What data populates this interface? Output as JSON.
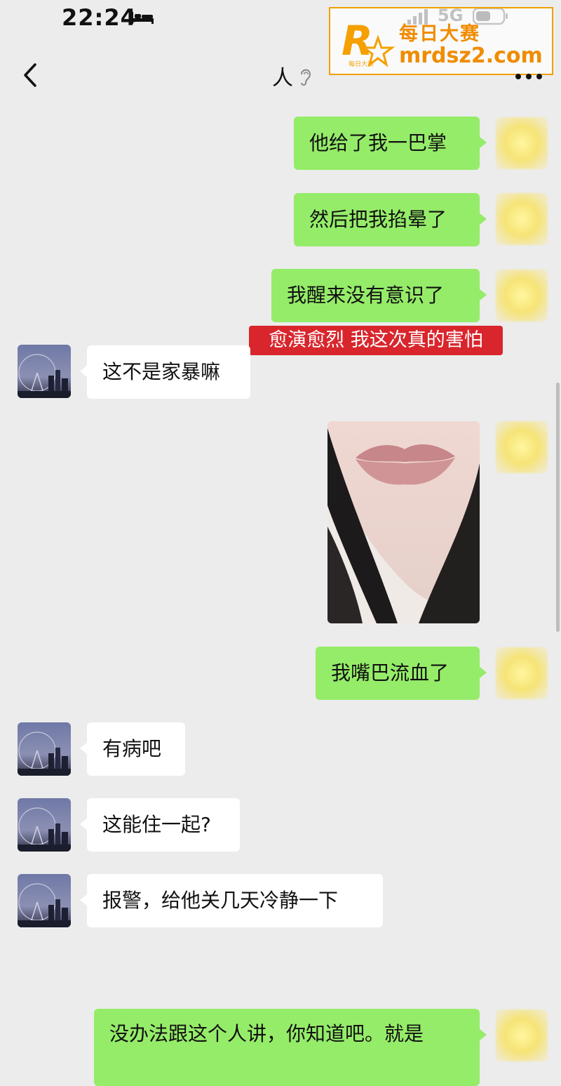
{
  "status_bar": {
    "time": "22:24",
    "network": "5G",
    "icons": [
      "bed-icon",
      "signal-icon",
      "battery-icon"
    ]
  },
  "header": {
    "title": "人",
    "icons": [
      "back-arrow-icon",
      "ear-icon",
      "more-icon"
    ]
  },
  "watermark": {
    "logo_letter": "R",
    "logo_small": "每日大赛",
    "name": "每日大赛",
    "url": "mrdsz2.com"
  },
  "messages": [
    {
      "sender": "me",
      "type": "text",
      "lines": [
        "他给了我一巴掌"
      ]
    },
    {
      "sender": "me",
      "type": "text",
      "lines": [
        "然后把我掐晕了"
      ]
    },
    {
      "sender": "me",
      "type": "text",
      "lines": [
        "我醒来没有意识了"
      ]
    },
    {
      "sender": "them",
      "type": "text",
      "lines": [
        "这不是家暴嘛"
      ]
    },
    {
      "sender": "me",
      "type": "image",
      "description": "photo-lips"
    },
    {
      "sender": "me",
      "type": "text",
      "lines": [
        "我嘴巴流血了"
      ]
    },
    {
      "sender": "them",
      "type": "text",
      "lines": [
        "有病吧"
      ]
    },
    {
      "sender": "them",
      "type": "text",
      "lines": [
        "这能住一起?"
      ]
    },
    {
      "sender": "them",
      "type": "text",
      "lines": [
        "报警，给他关几天冷静一下"
      ]
    },
    {
      "sender": "me",
      "type": "text",
      "lines": [
        "没办法跟这个人讲，你知道吧。就是"
      ]
    }
  ],
  "caption": "愈演愈烈 我这次真的害怕",
  "colors": {
    "my_bubble": "#95ec69",
    "their_bubble": "#ffffff",
    "background": "#ececec",
    "caption_bg": "#d8262c",
    "watermark": "#f08c00"
  }
}
